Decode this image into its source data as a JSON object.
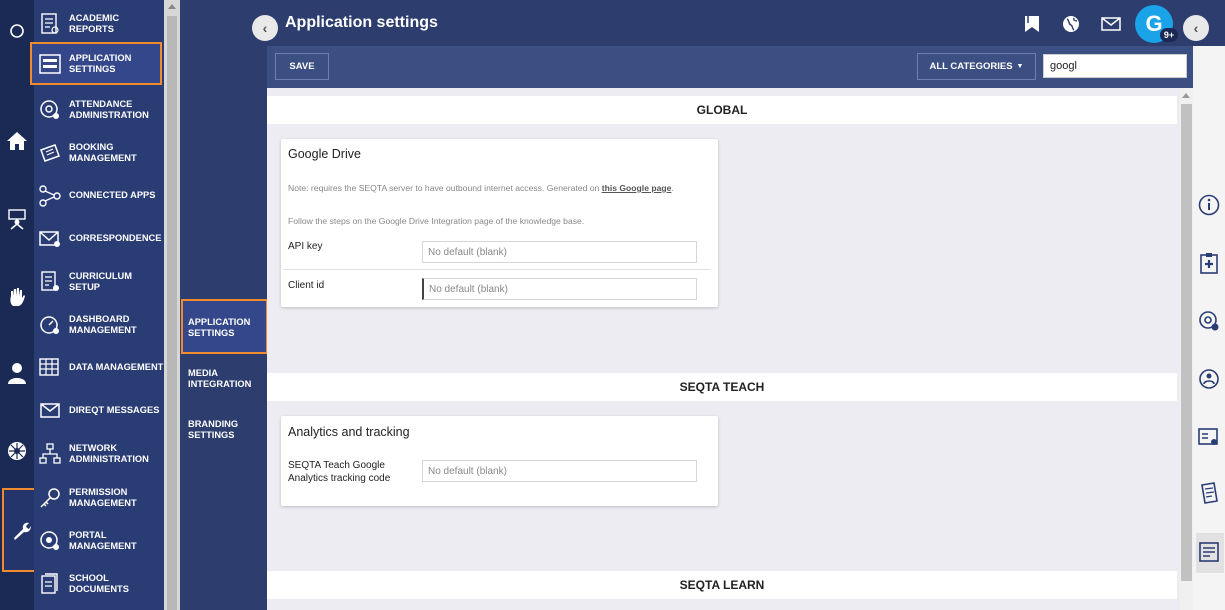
{
  "module_nav": {
    "items": [
      {
        "label": "ACADEMIC REPORTS"
      },
      {
        "label": "APPLICATION SETTINGS"
      },
      {
        "label": "ATTENDANCE ADMINISTRATION"
      },
      {
        "label": "BOOKING MANAGEMENT"
      },
      {
        "label": "CONNECTED APPS"
      },
      {
        "label": "CORRESPONDENCE"
      },
      {
        "label": "CURRICULUM SETUP"
      },
      {
        "label": "DASHBOARD MANAGEMENT"
      },
      {
        "label": "DATA MANAGEMENT"
      },
      {
        "label": "DIREQT MESSAGES"
      },
      {
        "label": "NETWORK ADMINISTRATION"
      },
      {
        "label": "PERMISSION MANAGEMENT"
      },
      {
        "label": "PORTAL MANAGEMENT"
      },
      {
        "label": "SCHOOL DOCUMENTS"
      }
    ]
  },
  "header": {
    "title": "Application settings",
    "avatar_letter": "G",
    "badge": "9+"
  },
  "toolbar": {
    "save_label": "SAVE",
    "category_label": "ALL CATEGORIES",
    "search_value": "googl"
  },
  "subnav": {
    "items": [
      {
        "label": "APPLICATION SETTINGS"
      },
      {
        "label": "MEDIA INTEGRATION"
      },
      {
        "label": "BRANDING SETTINGS"
      }
    ]
  },
  "sections": {
    "global": {
      "heading": "GLOBAL",
      "card_title": "Google Drive",
      "note_prefix": "Note: requires the SEQTA server to have outbound internet access. Generated on ",
      "note_link": "this Google page",
      "note_suffix": ".",
      "note2": "Follow the steps on the Google Drive Integration page of the knowledge base.",
      "api_key_label": "API key",
      "api_key_placeholder": "No default (blank)",
      "client_id_label": "Client id",
      "client_id_placeholder": "No default (blank)"
    },
    "teach": {
      "heading": "SEQTA TEACH",
      "card_title": "Analytics and tracking",
      "tracking_label": "SEQTA Teach Google Analytics tracking code",
      "tracking_placeholder": "No default (blank)"
    },
    "learn": {
      "heading": "SEQTA LEARN"
    }
  }
}
